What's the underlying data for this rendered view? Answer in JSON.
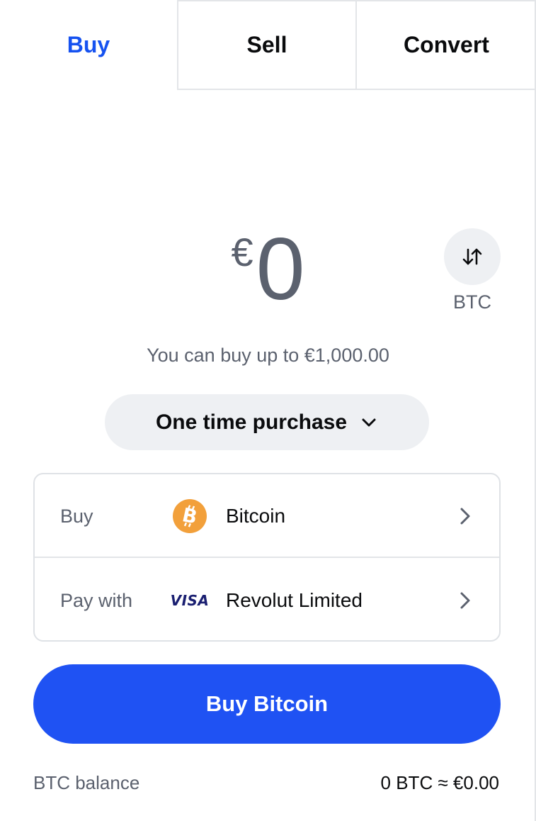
{
  "tabs": [
    {
      "label": "Buy",
      "active": true
    },
    {
      "label": "Sell",
      "active": false
    },
    {
      "label": "Convert",
      "active": false
    }
  ],
  "amount": {
    "currency_symbol": "€",
    "value": "0"
  },
  "switch": {
    "icon": "swap-vertical-icon",
    "label": "BTC"
  },
  "limit_text": "You can buy up to €1,000.00",
  "frequency": {
    "selected": "One time purchase",
    "icon": "chevron-down-icon"
  },
  "asset_row": {
    "label": "Buy",
    "icon": "bitcoin-icon",
    "value": "Bitcoin",
    "chevron": "chevron-right-icon"
  },
  "payment_row": {
    "label": "Pay with",
    "icon": "visa-icon",
    "icon_text": "VISA",
    "value": "Revolut Limited",
    "chevron": "chevron-right-icon"
  },
  "primary_button": {
    "label": "Buy Bitcoin"
  },
  "balance": {
    "label": "BTC balance",
    "value": "0 BTC ≈ €0.00"
  },
  "colors": {
    "accent": "#1652f0",
    "button": "#1f52f3",
    "bitcoin": "#f2a03b",
    "muted_text": "#5b616e",
    "pill_bg": "#eef0f3"
  }
}
